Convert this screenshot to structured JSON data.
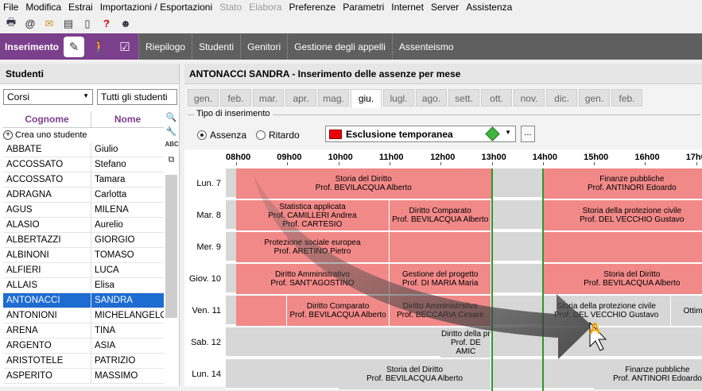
{
  "menu": [
    "File",
    "Modifica",
    "Estrai",
    "Importazioni / Esportazioni",
    "Stato",
    "Elabora",
    "Preferenze",
    "Parametri",
    "Internet",
    "Server",
    "Assistenza"
  ],
  "menu_disabled": [
    "Stato",
    "Elabora"
  ],
  "toolbar_icons": [
    "print-icon",
    "email-at-icon",
    "envelope-icon",
    "document-icon",
    "phone-icon",
    "help-key-icon",
    "users-icon"
  ],
  "nav": {
    "active": "Inserimento",
    "tabs": [
      "Riepilogo",
      "Studenti",
      "Genitori",
      "Gestione degli appelli",
      "Assenteismo"
    ]
  },
  "left": {
    "title": "Studenti",
    "courses_select": "Corsi",
    "students_select": "Tutti gli studenti",
    "col_surname": "Cognome",
    "col_name": "Nome",
    "create_label": "Crea uno studente",
    "students": [
      [
        "ABBATE",
        "Giulio"
      ],
      [
        "ACCOSSATO",
        "Stefano"
      ],
      [
        "ACCOSSATO",
        "Tamara"
      ],
      [
        "ADRAGNA",
        "Carlotta"
      ],
      [
        "AGUS",
        "MILENA"
      ],
      [
        "ALASIO",
        "Aurelio"
      ],
      [
        "ALBERTAZZI",
        "GIORGIO"
      ],
      [
        "ALBINONI",
        "TOMASO"
      ],
      [
        "ALFIERI",
        "LUCA"
      ],
      [
        "ALLAIS",
        "Elisa"
      ],
      [
        "ANTONACCI",
        "SANDRA"
      ],
      [
        "ANTONIONI",
        "MICHELANGELO"
      ],
      [
        "ARENA",
        "TINA"
      ],
      [
        "ARGENTO",
        "ASIA"
      ],
      [
        "ARISTOTELE",
        "PATRIZIO"
      ],
      [
        "ASPERITO",
        "MASSIMO"
      ]
    ],
    "selected_index": 10
  },
  "right": {
    "title": "ANTONACCI SANDRA - Inserimento delle assenze per mese",
    "months": [
      "gen.",
      "feb.",
      "mar.",
      "apr.",
      "mag.",
      "giu.",
      "lugl.",
      "ago.",
      "sett.",
      "ott.",
      "nov.",
      "dic.",
      "gen.",
      "feb."
    ],
    "active_month": "giu.",
    "entry_legend": "Tipo di inserimento",
    "radio_absence": "Assenza",
    "radio_delay": "Ritardo",
    "type_value": "Esclusione temporanea",
    "more_label": "...",
    "hours": [
      "08h00",
      "09h00",
      "10h00",
      "11h00",
      "12h00",
      "13h00",
      "14h00",
      "15h00",
      "16h00",
      "17h0"
    ],
    "days": [
      "Lun. 7",
      "Mar. 8",
      "Mer. 9",
      "Giov. 10",
      "Ven. 11",
      "Sab. 12",
      "Lun. 14"
    ],
    "lessons": {
      "mon7_a": [
        "Storia del Diritto",
        "Prof. BEVILACQUA Alberto"
      ],
      "mon7_b": [
        "Finanze pubbliche",
        "Prof. ANTINORI Edoardo"
      ],
      "tue8_a": [
        "Statistica applicata",
        "Prof. CAMILLERI Andrea",
        "Prof. CARTESIO"
      ],
      "tue8_b": [
        "Diritto Comparato",
        "Prof. BEVILACQUA Alberto"
      ],
      "tue8_c": [
        "Storia della protezione civile",
        "Prof. DEL VECCHIO Gustavo"
      ],
      "wed9_a": [
        "Protezione sociale europea",
        "Prof. ARETINO Pietro"
      ],
      "thu10_a": [
        "Diritto Amministrativo",
        "Prof. SANT'AGOSTINO"
      ],
      "thu10_b": [
        "Gestione del progetto",
        "Prof. DI MARIA Maria"
      ],
      "thu10_c": [
        "Storia del Diritto",
        "Prof. BEVILACQUA Alberto"
      ],
      "fri11_a": [
        "Diritto Comparato",
        "Prof. BEVILACQUA Alberto"
      ],
      "fri11_b": [
        "Diritto Amministrativo",
        "Prof. BECCARIA Cesare"
      ],
      "fri11_c": [
        "Storia della protezione civile",
        "Prof. DEL VECCHIO Gustavo"
      ],
      "fri11_d": [
        "Ottimiz"
      ],
      "sat12_a": [
        "Diritto della pr",
        "Prof. DE AMIC"
      ],
      "mon14_a": [
        "Storia del Diritto",
        "Prof. BEVILACQUA Alberto"
      ],
      "mon14_b": [
        "Finanze pubbliche",
        "Prof. ANTINORI Edoardo"
      ]
    }
  },
  "colors": {
    "accent": "#7b3f8c",
    "absence": "#f28989",
    "selection": "#1c6cd2",
    "type_swatch": "#e8000b"
  }
}
